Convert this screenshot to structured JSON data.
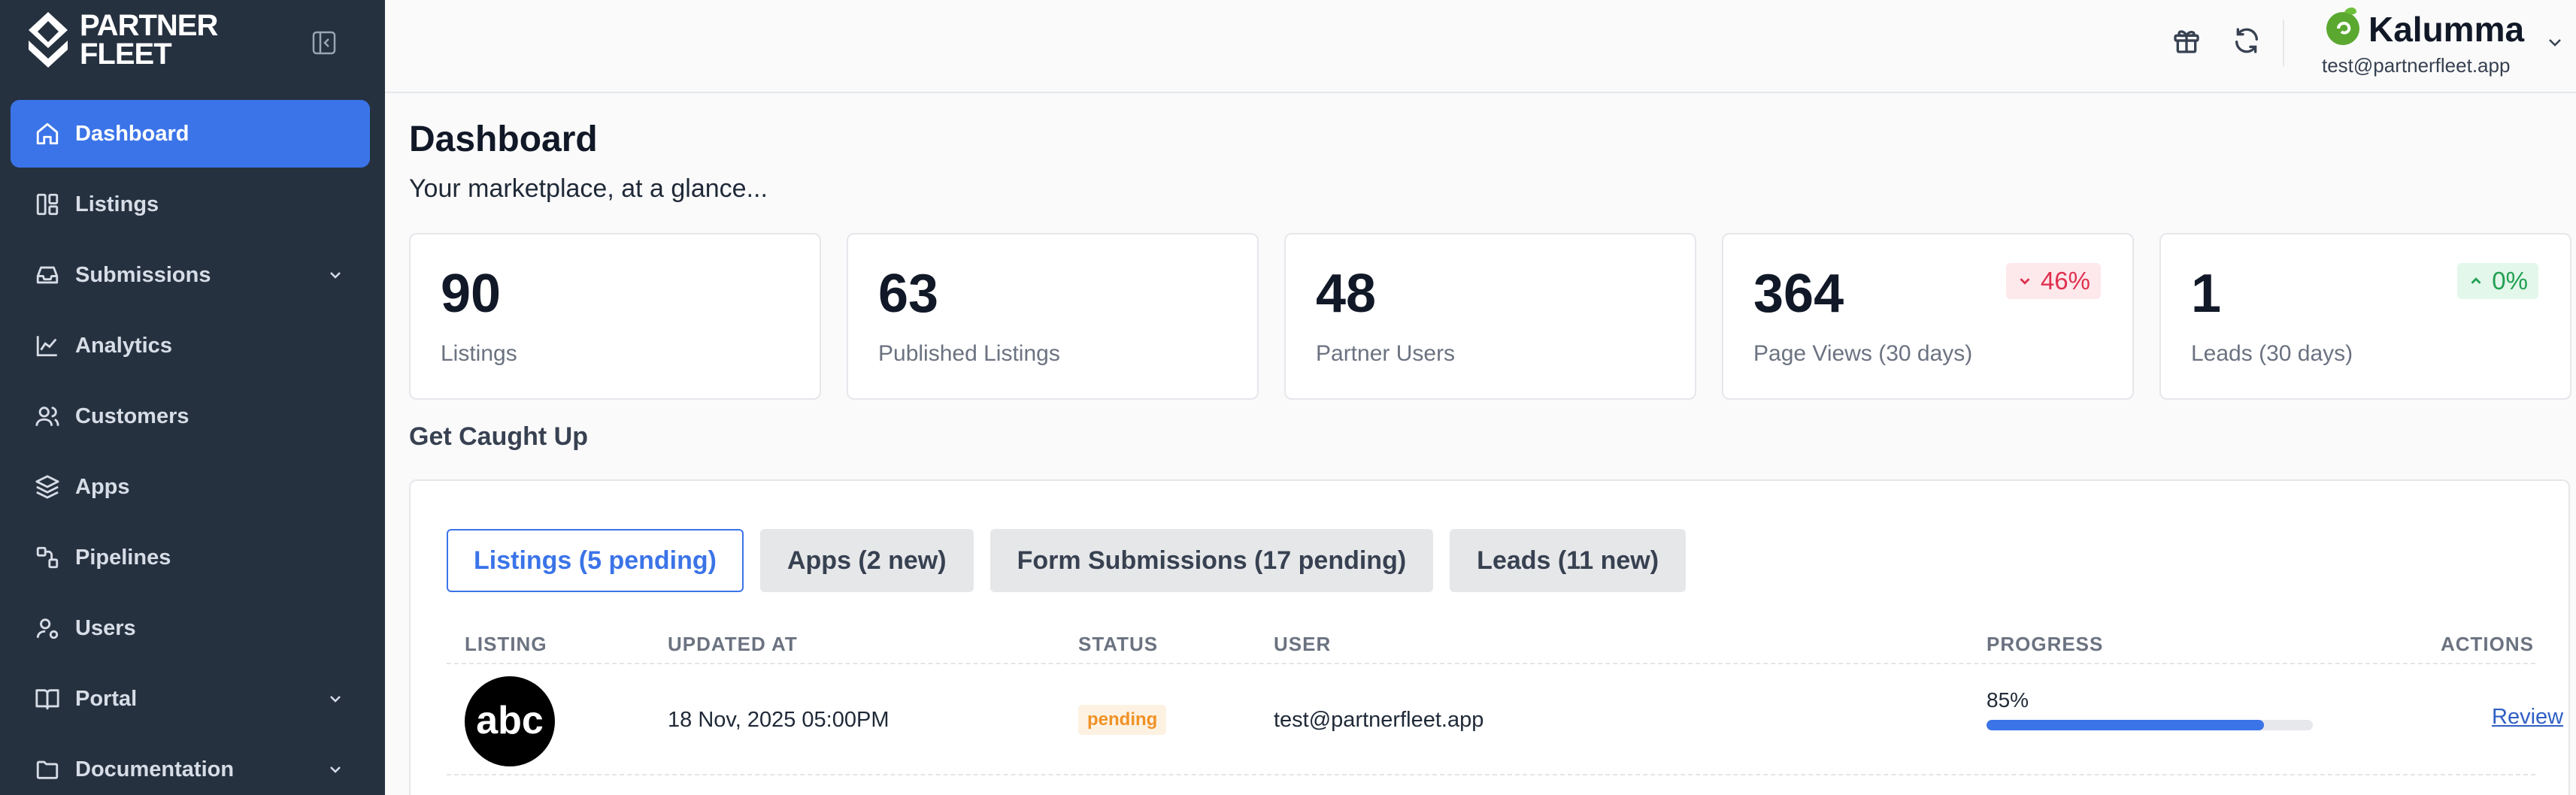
{
  "brand": {
    "line1": "PARTNER",
    "line2": "FLEET"
  },
  "sidebar": {
    "items": [
      {
        "label": "Dashboard",
        "icon": "home-icon",
        "active": true
      },
      {
        "label": "Listings",
        "icon": "layout-icon"
      },
      {
        "label": "Submissions",
        "icon": "inbox-icon",
        "expandable": true
      },
      {
        "label": "Analytics",
        "icon": "chart-line-icon"
      },
      {
        "label": "Customers",
        "icon": "users-icon"
      },
      {
        "label": "Apps",
        "icon": "layers-icon"
      },
      {
        "label": "Pipelines",
        "icon": "pipeline-icon"
      },
      {
        "label": "Users",
        "icon": "user-gear-icon"
      },
      {
        "label": "Portal",
        "icon": "book-icon",
        "expandable": true
      },
      {
        "label": "Documentation",
        "icon": "folder-icon",
        "expandable": true
      }
    ]
  },
  "header": {
    "org_name": "Kalumma",
    "org_email": "test@partnerfleet.app",
    "icons": [
      "gift-icon",
      "refresh-icon"
    ]
  },
  "page": {
    "title": "Dashboard",
    "subtitle": "Your marketplace, at a glance..."
  },
  "stats": [
    {
      "value": "90",
      "label": "Listings"
    },
    {
      "value": "63",
      "label": "Published Listings"
    },
    {
      "value": "48",
      "label": "Partner Users"
    },
    {
      "value": "364",
      "label": "Page Views (30 days)",
      "badge": "46%",
      "trend": "down"
    },
    {
      "value": "1",
      "label": "Leads (30 days)",
      "badge": "0%",
      "trend": "up"
    }
  ],
  "section": {
    "title": "Get Caught Up"
  },
  "tabs": [
    {
      "label": "Listings (5 pending)",
      "active": true
    },
    {
      "label": "Apps (2 new)"
    },
    {
      "label": "Form Submissions (17 pending)"
    },
    {
      "label": "Leads (11 new)"
    }
  ],
  "table": {
    "headers": [
      "LISTING",
      "UPDATED AT",
      "STATUS",
      "USER",
      "PROGRESS",
      "ACTIONS"
    ],
    "rows": [
      {
        "logo_text": "abc",
        "updated_at": "18 Nov, 2025 05:00PM",
        "status": "pending",
        "user": "test@partnerfleet.app",
        "progress_label": "85%",
        "progress": 0.85,
        "action": "Review"
      }
    ]
  },
  "colors": {
    "sidebar_bg": "#263140",
    "accent": "#3b74e8",
    "pending": "#f09226",
    "down": "#e0304e",
    "up": "#22a052"
  }
}
